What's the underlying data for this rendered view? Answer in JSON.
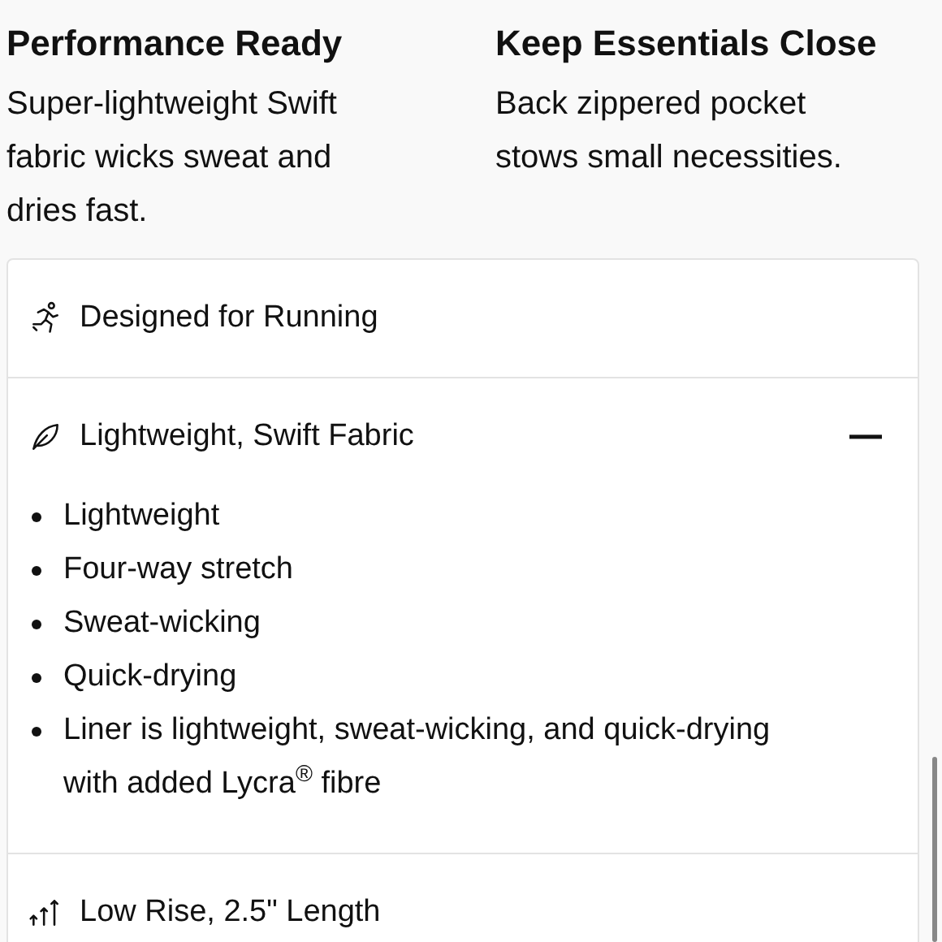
{
  "features": [
    {
      "title": "Performance Ready",
      "text": "Super-lightweight Swift fabric wicks sweat and dries fast."
    },
    {
      "title": "Keep Essentials Close",
      "text": "Back zippered pocket stows small necessities."
    }
  ],
  "accordion": [
    {
      "kind": "running",
      "label": "Designed for Running",
      "expanded": false
    },
    {
      "kind": "feather",
      "label": "Lightweight, Swift Fabric",
      "expanded": true,
      "bullets": [
        "Lightweight",
        "Four-way stretch",
        "Sweat-wicking",
        "Quick-drying",
        "Liner is lightweight, sweat-wicking, and quick-drying with added Lycra$^{®}$ fibre"
      ]
    },
    {
      "kind": "rise",
      "label": "Low Rise, 2.5\" Length",
      "expanded": false
    }
  ]
}
